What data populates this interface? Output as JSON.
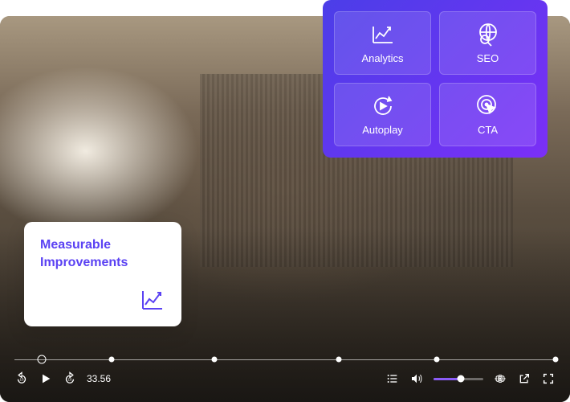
{
  "features": {
    "analytics": {
      "label": "Analytics"
    },
    "seo": {
      "label": "SEO"
    },
    "autoplay": {
      "label": "Autoplay"
    },
    "cta": {
      "label": "CTA"
    }
  },
  "callout": {
    "title": "Measurable Improvements"
  },
  "player": {
    "time": "33.56",
    "colors": {
      "accent": "#8b5cf6"
    }
  }
}
